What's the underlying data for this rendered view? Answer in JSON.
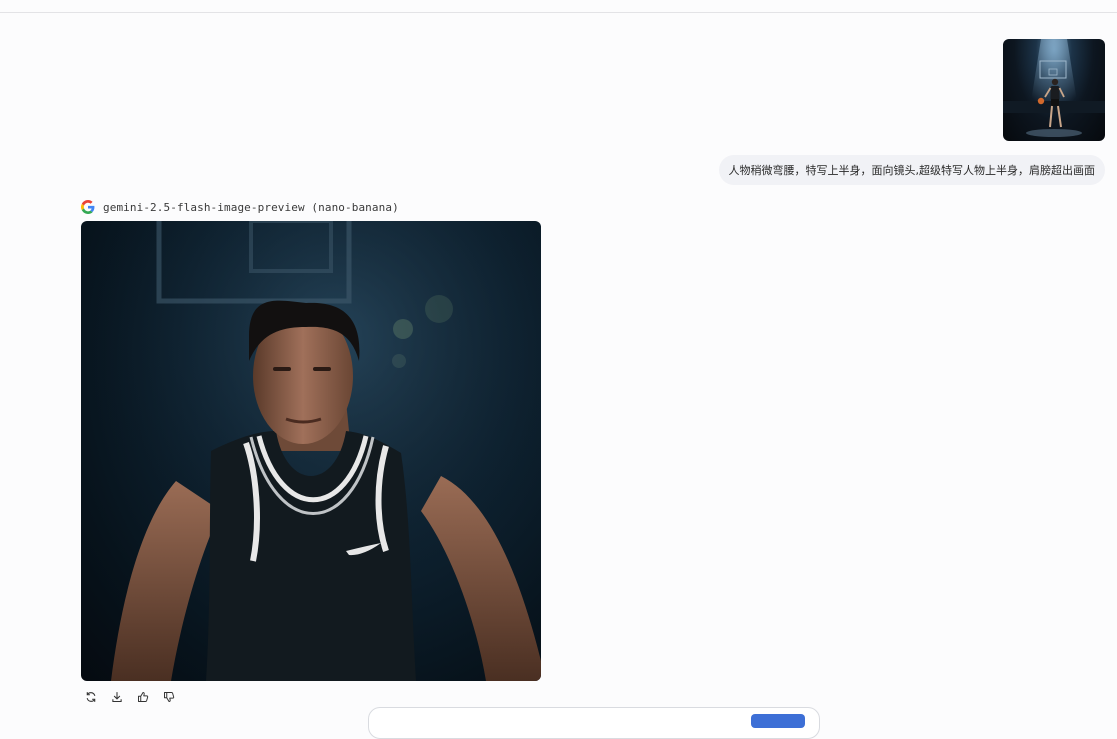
{
  "user_message": {
    "image_alt": "basketball player dribbling under spotlight",
    "text": "人物稍微弯腰，特写上半身，面向镜头,超级特写人物上半身，肩膀超出画面"
  },
  "model_response": {
    "model_name": "gemini-2.5-flash-image-preview (nano-banana)",
    "logo": "google-g-icon",
    "image_alt": "close-up of basketball player leaning toward camera"
  },
  "actions": [
    {
      "name": "regenerate-icon"
    },
    {
      "name": "download-icon"
    },
    {
      "name": "thumbs-up-icon"
    },
    {
      "name": "thumbs-down-icon"
    }
  ],
  "colors": {
    "background": "#fcfcfd",
    "bubble": "#f1f2f6",
    "send_button": "#3d6fd6"
  }
}
